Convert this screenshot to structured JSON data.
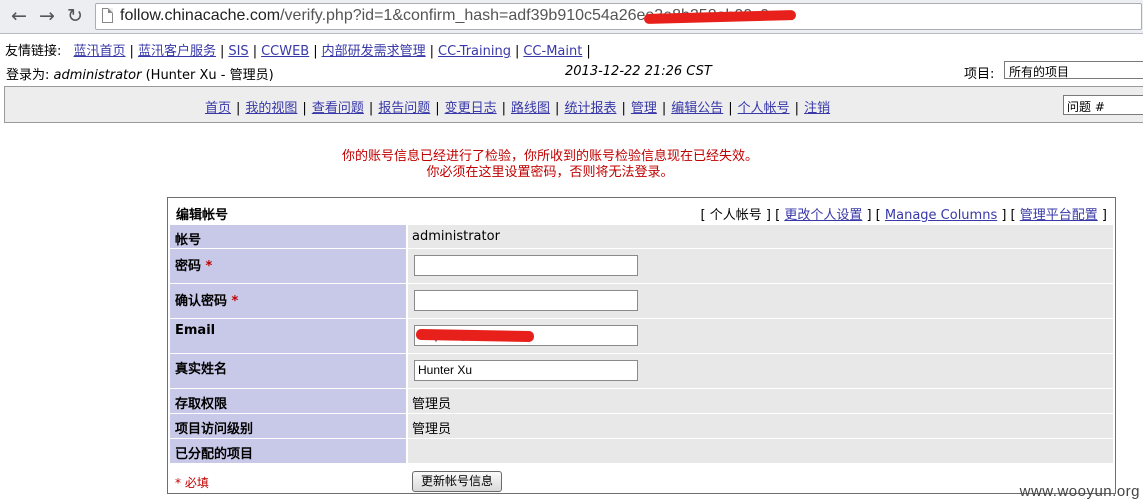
{
  "browser": {
    "url_host": "follow.chinacache.com",
    "url_path": "/verify.php?id=1&confirm_hash=adf39b910c54a26",
    "url_tail": "ee3e8b258ab00c0"
  },
  "toplinks": {
    "label": "友情链接:",
    "items": [
      "蓝汛首页",
      "蓝汛客户服务",
      "SIS",
      "CCWEB",
      "内部研发需求管理",
      "CC-Training",
      "CC-Maint"
    ]
  },
  "login": {
    "prefix": "登录为:",
    "user": "administrator",
    "role": "(Hunter Xu - 管理员)",
    "datetime": "2013-12-22 21:26 CST"
  },
  "project": {
    "label": "项目:",
    "selected": "所有的项目"
  },
  "menu": {
    "items": [
      "首页",
      "我的视图",
      "查看问题",
      "报告问题",
      "变更日志",
      "路线图",
      "统计报表",
      "管理",
      "编辑公告",
      "个人帐号",
      "注销"
    ],
    "issue_box": "问题 #"
  },
  "message": {
    "line1": "你的账号信息已经进行了检验，你所收到的账号检验信息现在已经失效。",
    "line2": "你必须在这里设置密码，否则将无法登录。"
  },
  "form": {
    "title": "编辑帐号",
    "links": {
      "current": "个人帐号",
      "prefs": "更改个人设置",
      "columns": "Manage Columns",
      "platform": "管理平台配置"
    },
    "rows": {
      "account": {
        "label": "帐号",
        "value": "administrator"
      },
      "password": {
        "label": "密码",
        "value": ""
      },
      "confirm": {
        "label": "确认密码",
        "value": ""
      },
      "email": {
        "label": "Email",
        "value": "xhq520@"
      },
      "realname": {
        "label": "真实姓名",
        "value": "Hunter Xu"
      },
      "access": {
        "label": "存取权限",
        "value": "管理员"
      },
      "project_level": {
        "label": "项目访问级别",
        "value": "管理员"
      },
      "assigned": {
        "label": "已分配的项目",
        "value": ""
      }
    },
    "required_star": "*",
    "required_note": "* 必填",
    "submit": "更新帐号信息"
  },
  "watermark": "www.wooyun.org",
  "colors": {
    "label_bg": "#c8c8e8",
    "value_bg": "#e8e8e8",
    "alert_red": "#c00000",
    "link": "#3838a8"
  }
}
